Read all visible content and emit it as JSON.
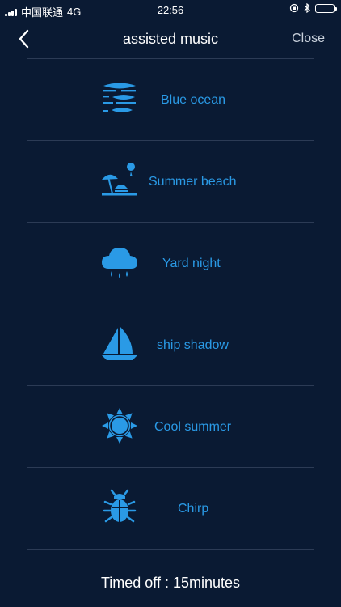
{
  "status_bar": {
    "carrier": "中国联通",
    "network": "4G",
    "time": "22:56"
  },
  "nav": {
    "title": "assisted music",
    "close_label": "Close"
  },
  "items": [
    {
      "label": "Blue ocean",
      "icon": "ocean-icon"
    },
    {
      "label": "Summer beach",
      "icon": "beach-icon"
    },
    {
      "label": "Yard night",
      "icon": "rain-cloud-icon"
    },
    {
      "label": "ship shadow",
      "icon": "sailboat-icon"
    },
    {
      "label": "Cool summer",
      "icon": "sun-icon"
    },
    {
      "label": "Chirp",
      "icon": "bug-icon"
    }
  ],
  "footer": {
    "timer_text": "Timed off : 15minutes"
  },
  "colors": {
    "background": "#0a1a33",
    "accent": "#2a9ae6",
    "divider": "#2c3b55"
  }
}
